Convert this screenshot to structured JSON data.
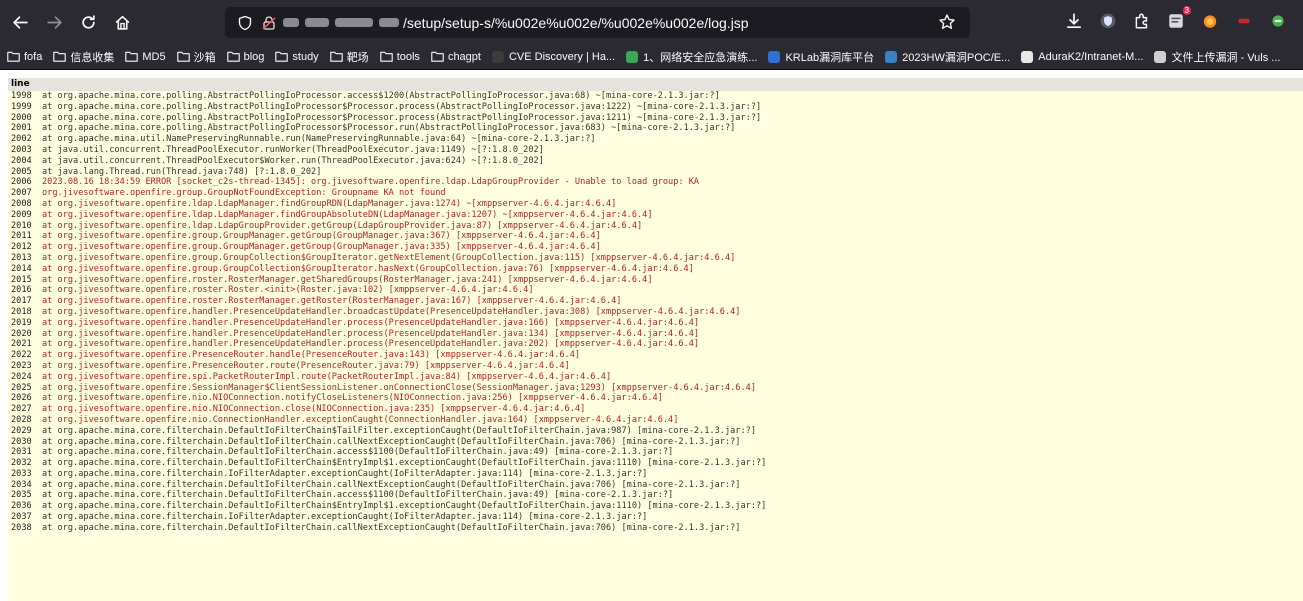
{
  "browser": {
    "url_path": "/setup/setup-s/%u002e%u002e/%u002e%u002e/log.jsp",
    "notification_count": "3"
  },
  "bookmarks": [
    {
      "label": "fofa",
      "kind": "folder"
    },
    {
      "label": "信息收集",
      "kind": "folder"
    },
    {
      "label": "MD5",
      "kind": "folder"
    },
    {
      "label": "沙箱",
      "kind": "folder"
    },
    {
      "label": "blog",
      "kind": "folder"
    },
    {
      "label": "study",
      "kind": "folder"
    },
    {
      "label": "靶场",
      "kind": "folder"
    },
    {
      "label": "tools",
      "kind": "folder"
    },
    {
      "label": "chagpt",
      "kind": "folder"
    },
    {
      "label": "CVE Discovery | Ha...",
      "kind": "site",
      "color": "#3c3c3c"
    },
    {
      "label": "1、网络安全应急演练...",
      "kind": "site",
      "color": "#3aa757"
    },
    {
      "label": "KRLab漏洞库平台",
      "kind": "site",
      "color": "#2f6fd6"
    },
    {
      "label": "2023HW漏洞POC/E...",
      "kind": "site",
      "color": "#3b82c4"
    },
    {
      "label": "AduraK2/Intranet-M...",
      "kind": "site",
      "color": "#e8e8e8"
    },
    {
      "label": "文件上传漏洞 - Vuls ...",
      "kind": "site",
      "color": "#cfcfcf"
    }
  ],
  "log": {
    "header": "line",
    "rows": [
      {
        "n": "1998",
        "text": "at org.apache.mina.core.polling.AbstractPollingIoProcessor.access$1200(AbstractPollingIoProcessor.java:68) ~[mina-core-2.1.3.jar:?]",
        "err": false
      },
      {
        "n": "1999",
        "text": "at org.apache.mina.core.polling.AbstractPollingIoProcessor$Processor.process(AbstractPollingIoProcessor.java:1222) ~[mina-core-2.1.3.jar:?]",
        "err": false
      },
      {
        "n": "2000",
        "text": "at org.apache.mina.core.polling.AbstractPollingIoProcessor$Processor.process(AbstractPollingIoProcessor.java:1211) ~[mina-core-2.1.3.jar:?]",
        "err": false
      },
      {
        "n": "2001",
        "text": "at org.apache.mina.core.polling.AbstractPollingIoProcessor$Processor.run(AbstractPollingIoProcessor.java:683) ~[mina-core-2.1.3.jar:?]",
        "err": false
      },
      {
        "n": "2002",
        "text": "at org.apache.mina.util.NamePreservingRunnable.run(NamePreservingRunnable.java:64) ~[mina-core-2.1.3.jar:?]",
        "err": false
      },
      {
        "n": "2003",
        "text": "at java.util.concurrent.ThreadPoolExecutor.runWorker(ThreadPoolExecutor.java:1149) ~[?:1.8.0_202]",
        "err": false
      },
      {
        "n": "2004",
        "text": "at java.util.concurrent.ThreadPoolExecutor$Worker.run(ThreadPoolExecutor.java:624) ~[?:1.8.0_202]",
        "err": false
      },
      {
        "n": "2005",
        "text": "at java.lang.Thread.run(Thread.java:748) [?:1.8.0_202]",
        "err": false
      },
      {
        "n": "2006",
        "text": "2023.08.16 18:34:59 ERROR [socket_c2s-thread-1345]: org.jivesoftware.openfire.ldap.LdapGroupProvider - Unable to load group: KA",
        "err": true
      },
      {
        "n": "2007",
        "text": "org.jivesoftware.openfire.group.GroupNotFoundException: Groupname KA not found",
        "err": true
      },
      {
        "n": "2008",
        "text": "at org.jivesoftware.openfire.ldap.LdapManager.findGroupRDN(LdapManager.java:1274) ~[xmppserver-4.6.4.jar:4.6.4]",
        "err": true
      },
      {
        "n": "2009",
        "text": "at org.jivesoftware.openfire.ldap.LdapManager.findGroupAbsoluteDN(LdapManager.java:1207) ~[xmppserver-4.6.4.jar:4.6.4]",
        "err": true
      },
      {
        "n": "2010",
        "text": "at org.jivesoftware.openfire.ldap.LdapGroupProvider.getGroup(LdapGroupProvider.java:87) [xmppserver-4.6.4.jar:4.6.4]",
        "err": true
      },
      {
        "n": "2011",
        "text": "at org.jivesoftware.openfire.group.GroupManager.getGroup(GroupManager.java:367) [xmppserver-4.6.4.jar:4.6.4]",
        "err": true
      },
      {
        "n": "2012",
        "text": "at org.jivesoftware.openfire.group.GroupManager.getGroup(GroupManager.java:335) [xmppserver-4.6.4.jar:4.6.4]",
        "err": true
      },
      {
        "n": "2013",
        "text": "at org.jivesoftware.openfire.group.GroupCollection$GroupIterator.getNextElement(GroupCollection.java:115) [xmppserver-4.6.4.jar:4.6.4]",
        "err": true
      },
      {
        "n": "2014",
        "text": "at org.jivesoftware.openfire.group.GroupCollection$GroupIterator.hasNext(GroupCollection.java:76) [xmppserver-4.6.4.jar:4.6.4]",
        "err": true
      },
      {
        "n": "2015",
        "text": "at org.jivesoftware.openfire.roster.RosterManager.getSharedGroups(RosterManager.java:241) [xmppserver-4.6.4.jar:4.6.4]",
        "err": true
      },
      {
        "n": "2016",
        "text": "at org.jivesoftware.openfire.roster.Roster.<init>(Roster.java:102) [xmppserver-4.6.4.jar:4.6.4]",
        "err": true
      },
      {
        "n": "2017",
        "text": "at org.jivesoftware.openfire.roster.RosterManager.getRoster(RosterManager.java:167) [xmppserver-4.6.4.jar:4.6.4]",
        "err": true
      },
      {
        "n": "2018",
        "text": "at org.jivesoftware.openfire.handler.PresenceUpdateHandler.broadcastUpdate(PresenceUpdateHandler.java:308) [xmppserver-4.6.4.jar:4.6.4]",
        "err": true
      },
      {
        "n": "2019",
        "text": "at org.jivesoftware.openfire.handler.PresenceUpdateHandler.process(PresenceUpdateHandler.java:166) [xmppserver-4.6.4.jar:4.6.4]",
        "err": true
      },
      {
        "n": "2020",
        "text": "at org.jivesoftware.openfire.handler.PresenceUpdateHandler.process(PresenceUpdateHandler.java:134) [xmppserver-4.6.4.jar:4.6.4]",
        "err": true
      },
      {
        "n": "2021",
        "text": "at org.jivesoftware.openfire.handler.PresenceUpdateHandler.process(PresenceUpdateHandler.java:202) [xmppserver-4.6.4.jar:4.6.4]",
        "err": true
      },
      {
        "n": "2022",
        "text": "at org.jivesoftware.openfire.PresenceRouter.handle(PresenceRouter.java:143) [xmppserver-4.6.4.jar:4.6.4]",
        "err": true
      },
      {
        "n": "2023",
        "text": "at org.jivesoftware.openfire.PresenceRouter.route(PresenceRouter.java:79) [xmppserver-4.6.4.jar:4.6.4]",
        "err": true
      },
      {
        "n": "2024",
        "text": "at org.jivesoftware.openfire.spi.PacketRouterImpl.route(PacketRouterImpl.java:84) [xmppserver-4.6.4.jar:4.6.4]",
        "err": true
      },
      {
        "n": "2025",
        "text": "at org.jivesoftware.openfire.SessionManager$ClientSessionListener.onConnectionClose(SessionManager.java:1293) [xmppserver-4.6.4.jar:4.6.4]",
        "err": true
      },
      {
        "n": "2026",
        "text": "at org.jivesoftware.openfire.nio.NIOConnection.notifyCloseListeners(NIOConnection.java:256) [xmppserver-4.6.4.jar:4.6.4]",
        "err": true
      },
      {
        "n": "2027",
        "text": "at org.jivesoftware.openfire.nio.NIOConnection.close(NIOConnection.java:235) [xmppserver-4.6.4.jar:4.6.4]",
        "err": true
      },
      {
        "n": "2028",
        "text": "at org.jivesoftware.openfire.nio.ConnectionHandler.exceptionCaught(ConnectionHandler.java:164) [xmppserver-4.6.4.jar:4.6.4]",
        "err": true
      },
      {
        "n": "2029",
        "text": "at org.apache.mina.core.filterchain.DefaultIoFilterChain$TailFilter.exceptionCaught(DefaultIoFilterChain.java:987) [mina-core-2.1.3.jar:?]",
        "err": false
      },
      {
        "n": "2030",
        "text": "at org.apache.mina.core.filterchain.DefaultIoFilterChain.callNextExceptionCaught(DefaultIoFilterChain.java:706) [mina-core-2.1.3.jar:?]",
        "err": false
      },
      {
        "n": "2031",
        "text": "at org.apache.mina.core.filterchain.DefaultIoFilterChain.access$1100(DefaultIoFilterChain.java:49) [mina-core-2.1.3.jar:?]",
        "err": false
      },
      {
        "n": "2032",
        "text": "at org.apache.mina.core.filterchain.DefaultIoFilterChain$EntryImpl$1.exceptionCaught(DefaultIoFilterChain.java:1110) [mina-core-2.1.3.jar:?]",
        "err": false
      },
      {
        "n": "2033",
        "text": "at org.apache.mina.core.filterchain.IoFilterAdapter.exceptionCaught(IoFilterAdapter.java:114) [mina-core-2.1.3.jar:?]",
        "err": false
      },
      {
        "n": "2034",
        "text": "at org.apache.mina.core.filterchain.DefaultIoFilterChain.callNextExceptionCaught(DefaultIoFilterChain.java:706) [mina-core-2.1.3.jar:?]",
        "err": false
      },
      {
        "n": "2035",
        "text": "at org.apache.mina.core.filterchain.DefaultIoFilterChain.access$1100(DefaultIoFilterChain.java:49) [mina-core-2.1.3.jar:?]",
        "err": false
      },
      {
        "n": "2036",
        "text": "at org.apache.mina.core.filterchain.DefaultIoFilterChain$EntryImpl$1.exceptionCaught(DefaultIoFilterChain.java:1110) [mina-core-2.1.3.jar:?]",
        "err": false
      },
      {
        "n": "2037",
        "text": "at org.apache.mina.core.filterchain.IoFilterAdapter.exceptionCaught(IoFilterAdapter.java:114) [mina-core-2.1.3.jar:?]",
        "err": false
      },
      {
        "n": "2038",
        "text": "at org.apache.mina.core.filterchain.DefaultIoFilterChain.callNextExceptionCaught(DefaultIoFilterChain.java:706) [mina-core-2.1.3.jar:?]",
        "err": false
      }
    ]
  }
}
